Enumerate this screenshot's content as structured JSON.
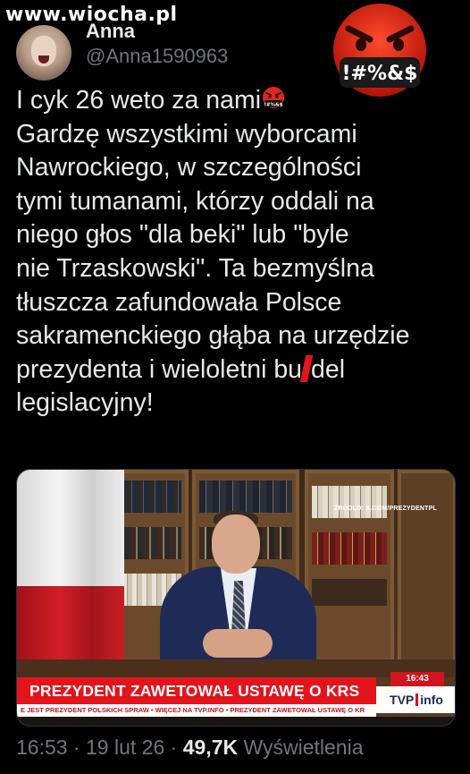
{
  "watermark": "www.wiocha.pl",
  "author": {
    "display_name": "Anna",
    "handle": "@Anna1590963"
  },
  "emoji": {
    "big": "angry-face-with-symbols-emoji",
    "big_symbols": "!#%&$",
    "inline": "angry-face-with-symbols-emoji",
    "inline_symbols": "!#%&$"
  },
  "tweet": {
    "lines": [
      "I cyk 26 weto za nami",
      "Gardzę wszystkimi wyborcami",
      "Nawrockiego, w szczególności",
      "tymi tumanami, którzy oddali na",
      "niego głos \"dla beki\" lub \"byle",
      "nie Trzaskowski\". Ta bezmyślna",
      "tłuszcza zafundowała Polsce",
      "sakramenckiego głąba na urzędzie",
      "prezydenta i wieloletni bu",
      "legislacyjny!"
    ],
    "censored_tail": "del"
  },
  "media": {
    "source": "ŹRÓDŁO: X.COM/PREZYDENTPL",
    "time": "16:43",
    "headline": "PREZYDENT ZAWETOWAŁ USTAWĘ O KRS",
    "channel": "TVP",
    "channel_suffix": "info",
    "crawl": "E JEST PREZYDENT POLSKICH SPRAW • WIĘCEJ NA TVP.INFO • PREZYDENT ZAWETOWAŁ USTAWĘ O KR"
  },
  "meta": {
    "time": "16:53",
    "sep1": " · ",
    "date": "19 lut 26",
    "sep2": " · ",
    "views": "49,7K",
    "views_label": " Wyświetlenia"
  },
  "colors": {
    "background": "#000000",
    "text": "#e7e9ea",
    "muted": "#71767b",
    "tvp_red": "#e3141c",
    "flag_red": "#d21f26"
  }
}
